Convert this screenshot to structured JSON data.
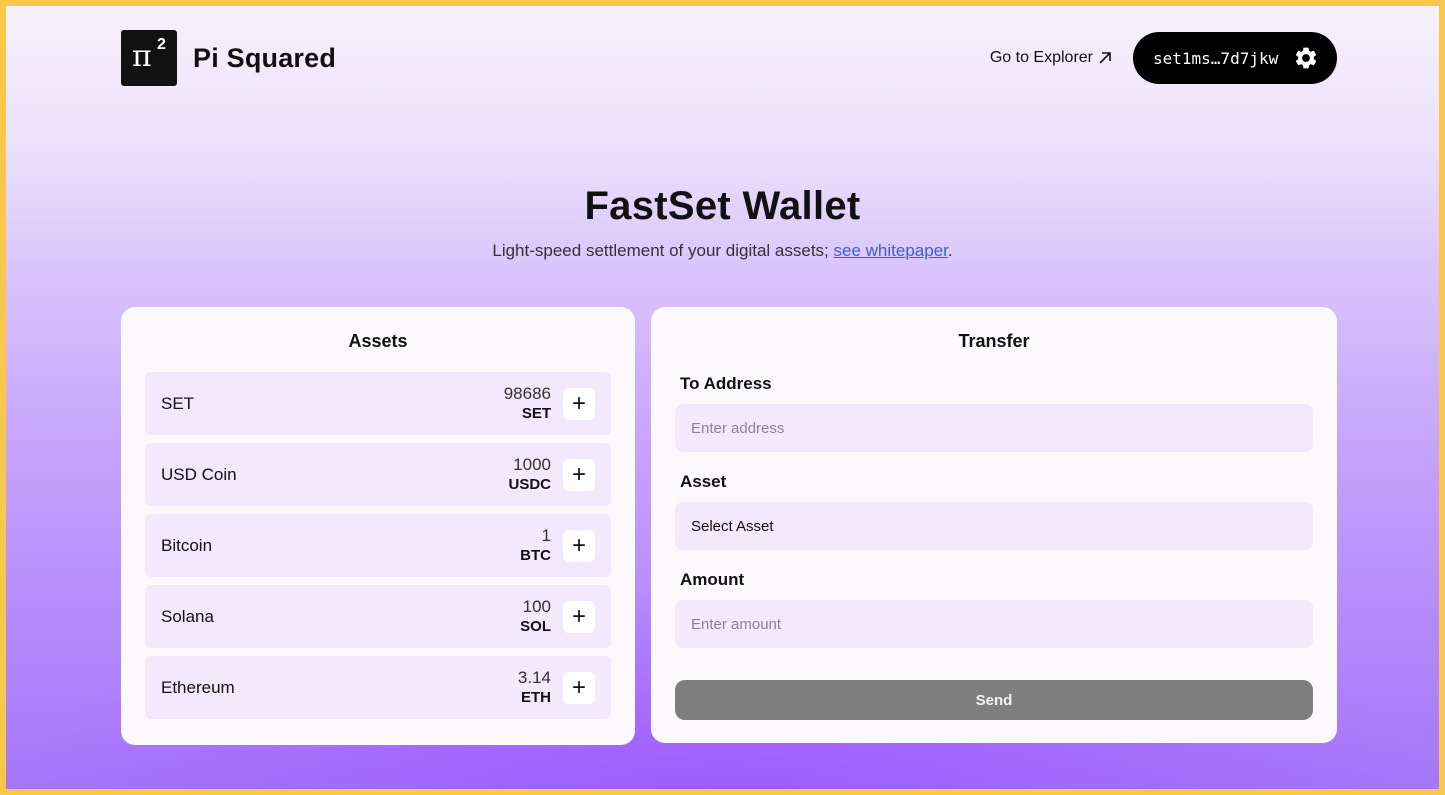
{
  "header": {
    "logo_symbol": "π",
    "logo_superscript": "2",
    "brand_name": "Pi Squared",
    "explorer_link": "Go to Explorer",
    "explorer_icon": "arrow-up-right-icon",
    "wallet_address": "set1ms…7d7jkw",
    "settings_icon": "gear-icon"
  },
  "hero": {
    "title": "FastSet Wallet",
    "subtitle_prefix": "Light-speed settlement of your digital assets; ",
    "subtitle_link": "see whitepaper",
    "subtitle_suffix": "."
  },
  "assets": {
    "title": "Assets",
    "items": [
      {
        "name": "SET",
        "amount": "98686",
        "symbol": "SET"
      },
      {
        "name": "USD Coin",
        "amount": "1000",
        "symbol": "USDC"
      },
      {
        "name": "Bitcoin",
        "amount": "1",
        "symbol": "BTC"
      },
      {
        "name": "Solana",
        "amount": "100",
        "symbol": "SOL"
      },
      {
        "name": "Ethereum",
        "amount": "3.14",
        "symbol": "ETH"
      }
    ],
    "add_button_icon": "plus-icon",
    "add_button_glyph": "+"
  },
  "transfer": {
    "title": "Transfer",
    "to_label": "To Address",
    "to_placeholder": "Enter address",
    "to_value": "",
    "asset_label": "Asset",
    "asset_selected": "Select Asset",
    "amount_label": "Amount",
    "amount_placeholder": "Enter amount",
    "amount_value": "",
    "send_label": "Send"
  },
  "colors": {
    "frame_border": "#f8c84a",
    "card_bg": "#fbf9fc",
    "row_bg": "#f2e9fc",
    "link": "#3d5fd6",
    "send_disabled": "#7e7e7e",
    "pill_bg": "#000000"
  }
}
